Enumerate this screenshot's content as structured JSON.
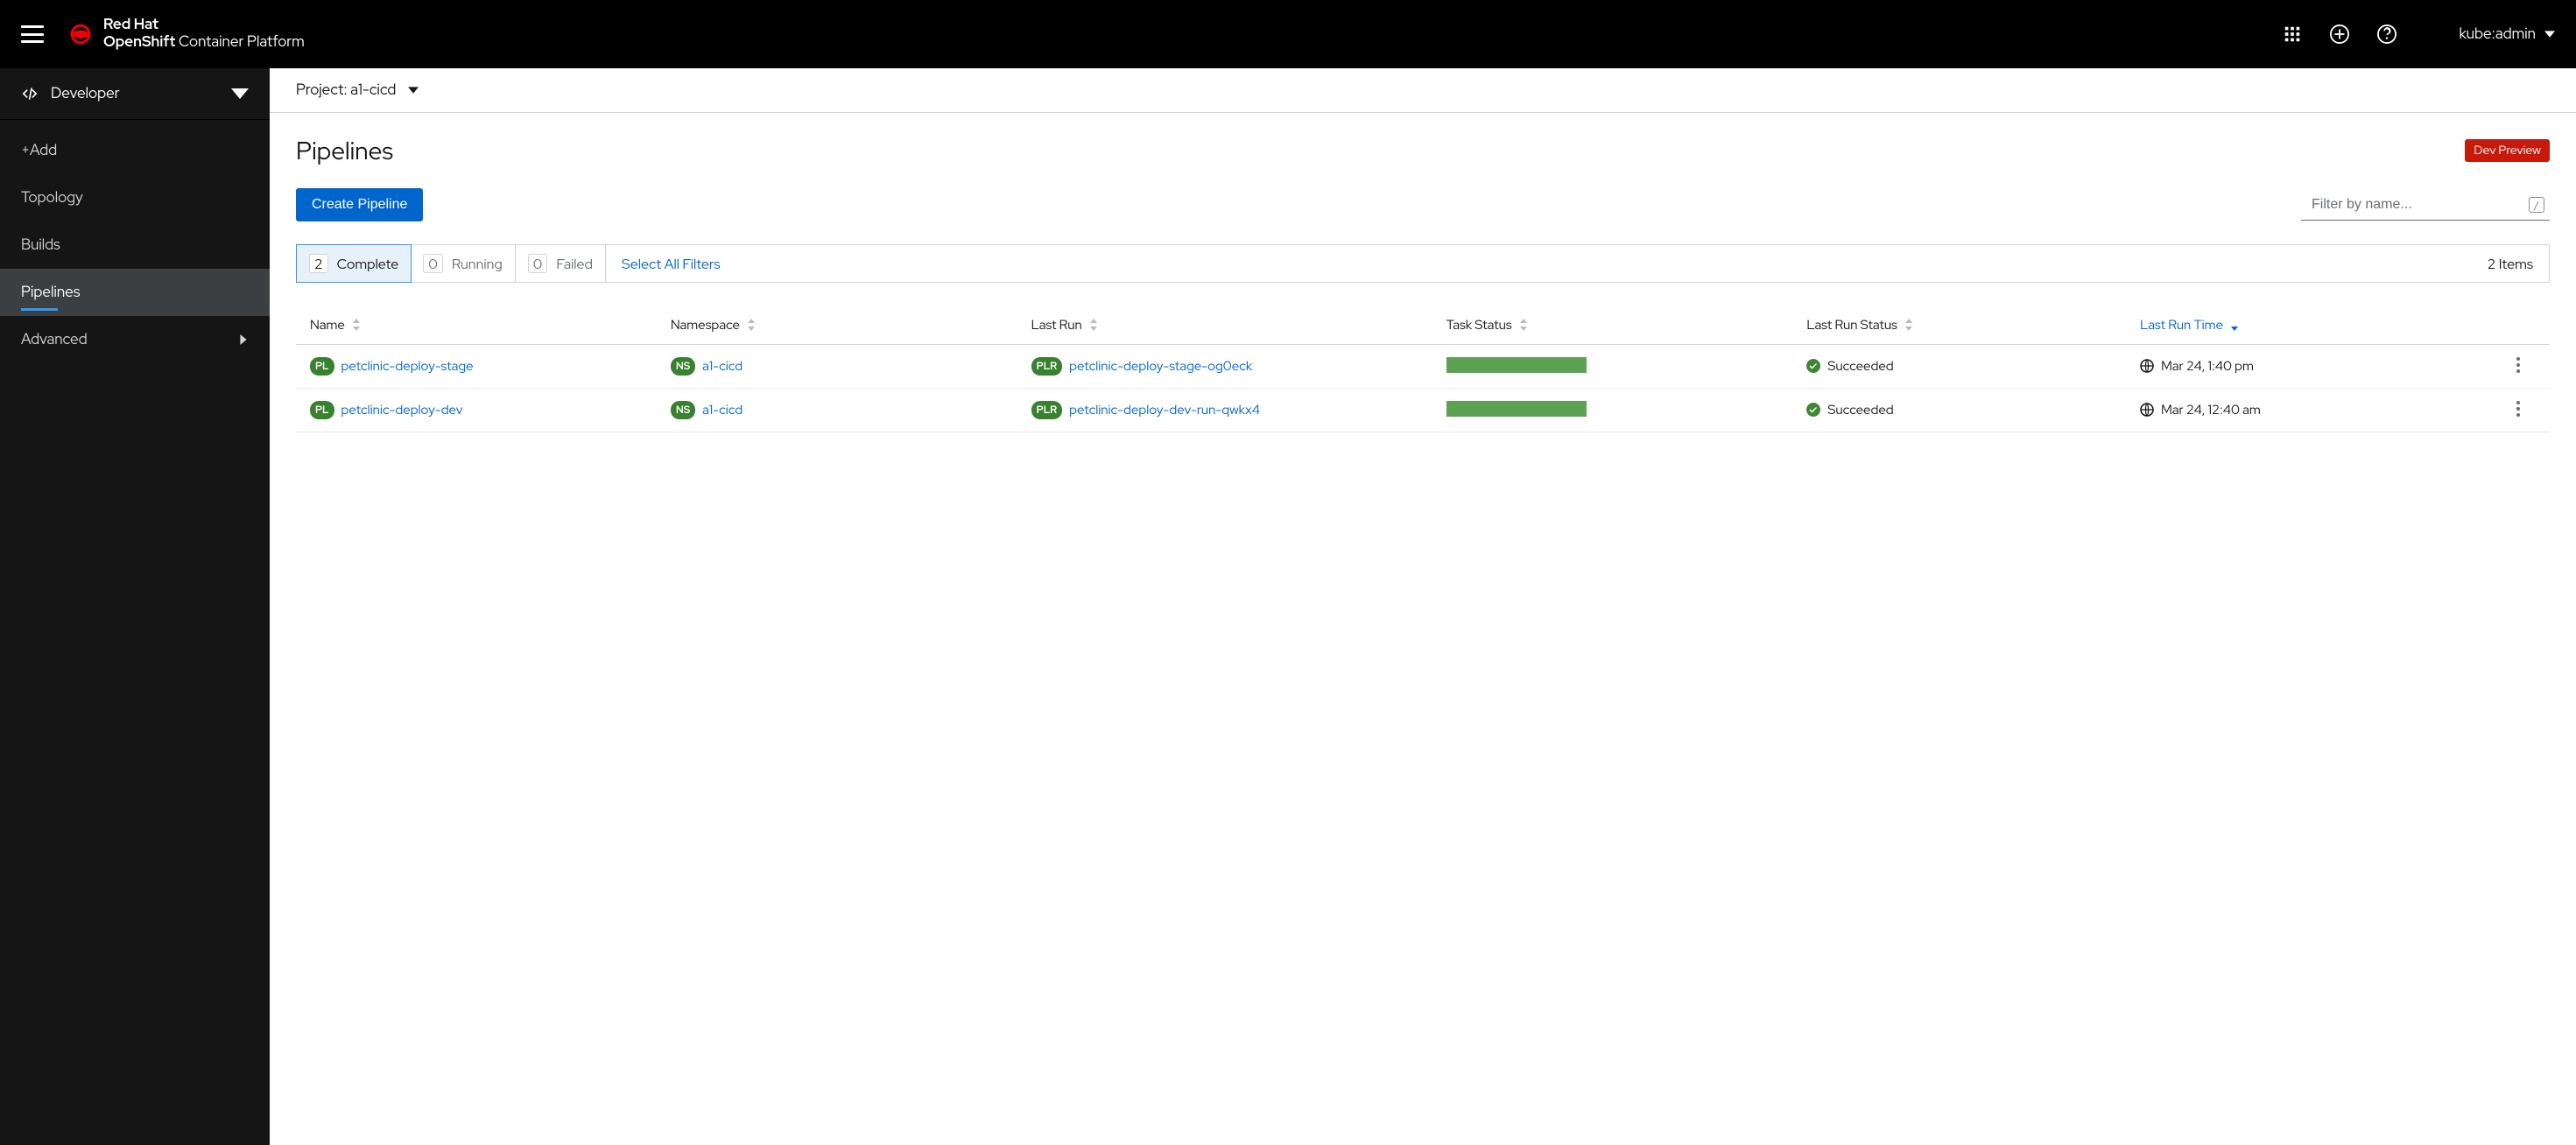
{
  "brand": {
    "line1": "Red Hat",
    "line2_bold": "OpenShift",
    "line2_rest": " Container Platform"
  },
  "user": "kube:admin",
  "perspective": "Developer",
  "nav": {
    "add": "+Add",
    "topology": "Topology",
    "builds": "Builds",
    "pipelines": "Pipelines",
    "advanced": "Advanced"
  },
  "project": {
    "label": "Project: a1-cicd"
  },
  "page": {
    "title": "Pipelines",
    "dev_preview": "Dev Preview",
    "create_btn": "Create Pipeline",
    "filter_placeholder": "Filter by name..."
  },
  "filters": {
    "complete": {
      "count": "2",
      "label": "Complete"
    },
    "running": {
      "count": "0",
      "label": "Running"
    },
    "failed": {
      "count": "0",
      "label": "Failed"
    },
    "select_all": "Select All Filters",
    "items": "2 Items"
  },
  "columns": {
    "name": "Name",
    "namespace": "Namespace",
    "lastrun": "Last Run",
    "taskstatus": "Task Status",
    "lastrunstatus": "Last Run Status",
    "lastruntime": "Last Run Time"
  },
  "rows": [
    {
      "name": "petclinic-deploy-stage",
      "namespace": "a1-cicd",
      "lastrun": "petclinic-deploy-stage-og0eck",
      "status": "Succeeded",
      "time": "Mar 24, 1:40 pm"
    },
    {
      "name": "petclinic-deploy-dev",
      "namespace": "a1-cicd",
      "lastrun": "petclinic-deploy-dev-run-qwkx4",
      "status": "Succeeded",
      "time": "Mar 24, 12:40 am"
    }
  ],
  "badges": {
    "pl": "PL",
    "ns": "NS",
    "plr": "PLR"
  }
}
